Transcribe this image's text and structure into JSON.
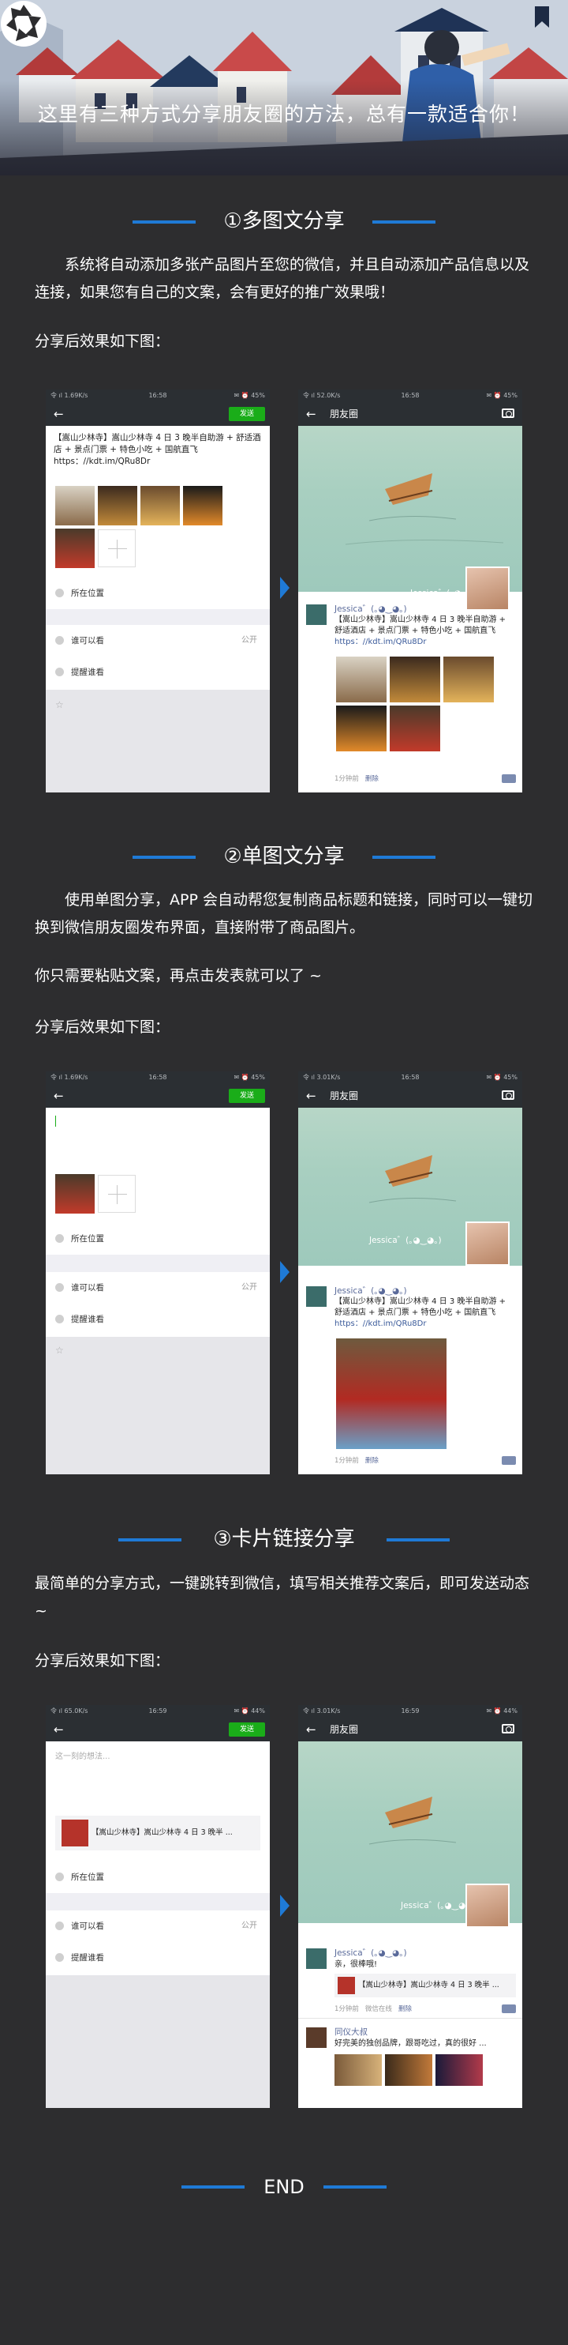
{
  "banner": {
    "title": "这里有三种方式分享朋友圈的方法，总有一款适合你！"
  },
  "sections": [
    {
      "heading": "①多图文分享",
      "paragraphs": [
        "系统将自动添加多张产品图片至您的微信，并且自动添加产品信息以及连接，如果您有自己的文案，会有更好的推广效果哦！",
        "分享后效果如下图："
      ]
    },
    {
      "heading": "②单图文分享",
      "paragraphs": [
        "使用单图分享，APP 会自动帮您复制商品标题和链接，同时可以一键切换到微信朋友圈发布界面，直接附带了商品图片。",
        "你只需要粘贴文案，再点击发表就可以了 ~",
        "分享后效果如下图："
      ]
    },
    {
      "heading": "③卡片链接分享",
      "paragraphs": [
        "最简单的分享方式，一键跳转到微信，填写相关推荐文案后，即可发送动态 ~",
        "分享后效果如下图："
      ]
    }
  ],
  "end_text": "END",
  "colors": {
    "page_bg": "#2d2d2f",
    "accent_blue": "#1f7ad6",
    "wechat_green": "#1aad19"
  },
  "compose": {
    "send_label": "发送",
    "location_label": "所在位置",
    "visibility_label": "谁可以看",
    "visibility_value": "公开",
    "remind_label": "提醒谁看",
    "placeholder": "这一刻的想法...",
    "post_text": "【嵩山少林寺】嵩山少林寺 4 日 3 晚半自助游 + 舒适酒店 + 景点门票 + 特色小吃 + 国航直飞",
    "post_link": "https：//kdt.im/QRu8Dr",
    "card_title": "【嵩山少林寺】嵩山少林寺 4 日 3 晚半 ..."
  },
  "moments": {
    "title": "朋友圈",
    "nickname": "Jessica゛(｡◕‿◕｡)",
    "post_text": "【嵩山少林寺】嵩山少林寺 4 日 3 晚半自助游 + 舒适酒店 + 景点门票 + 特色小吃 + 国航直飞",
    "post_link": "https：//kdt.im/QRu8Dr",
    "time": "1分钟前",
    "delete": "删除",
    "card_comment": "亲，很棒哦!",
    "card_title": "【嵩山少林寺】嵩山少林寺 4 日 3 晚半 ...",
    "card_meta_source": "微信在线",
    "other_user": "同仪大叔",
    "other_text": "好完美的独创品牌，跟哥吃过，真的很好 ..."
  },
  "status_bars": [
    {
      "left": "令 ıl 1.69K/s",
      "center": "16:58",
      "right": "✉ ⏰ 45%"
    },
    {
      "left": "令 ıl 52.0K/s",
      "center": "16:58",
      "right": "✉ ⏰ 45%"
    },
    {
      "left": "令 ıl 1.69K/s",
      "center": "16:58",
      "right": "✉ ⏰ 45%"
    },
    {
      "left": "令 ıl 3.01K/s",
      "center": "16:58",
      "right": "✉ ⏰ 45%"
    },
    {
      "left": "令 ıl 65.0K/s",
      "center": "16:59",
      "right": "✉ ⏰ 44%"
    },
    {
      "left": "令 ıl 3.01K/s",
      "center": "16:59",
      "right": "✉ ⏰ 44%"
    }
  ]
}
